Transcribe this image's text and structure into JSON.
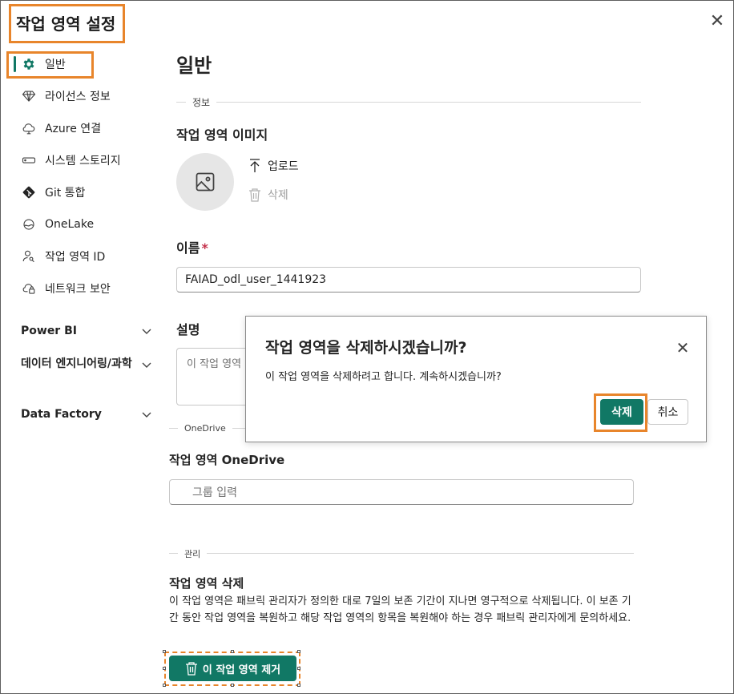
{
  "window": {
    "title": "작업 영역 설정",
    "close_icon": "close-icon"
  },
  "sidebar": {
    "items": [
      {
        "label": "일반",
        "icon": "gear-icon",
        "selected": true
      },
      {
        "label": "라이선스 정보",
        "icon": "diamond-icon"
      },
      {
        "label": "Azure 연결",
        "icon": "cloud-icon"
      },
      {
        "label": "시스템 스토리지",
        "icon": "storage-icon"
      },
      {
        "label": "Git 통합",
        "icon": "git-icon"
      },
      {
        "label": "OneLake",
        "icon": "onelake-icon"
      },
      {
        "label": "작업 영역 ID",
        "icon": "person-key-icon"
      },
      {
        "label": "네트워크 보안",
        "icon": "cloud-lock-icon"
      }
    ],
    "sections": [
      {
        "label": "Power BI"
      },
      {
        "label": "데이터 엔지니어링/과학"
      },
      {
        "label": "Data Factory"
      }
    ]
  },
  "main": {
    "heading": "일반",
    "info_section": "정보",
    "workspace_image_label": "작업 영역 이미지",
    "upload_label": "업로드",
    "delete_image_label": "삭제",
    "name_label": "이름",
    "required_mark": "*",
    "name_value": "FAIAD_odl_user_1441923",
    "description_label": "설명",
    "description_placeholder": "이 작업 영역",
    "onedrive_section": "OneDrive",
    "onedrive_label": "작업 영역 OneDrive",
    "onedrive_placeholder": "그룹 입력",
    "manage_section": "관리",
    "delete_ws_label": "작업 영역 삭제",
    "delete_ws_text": "이 작업 영역은 패브릭 관리자가 정의한 대로 7일의 보존 기간이 지나면 영구적으로 삭제됩니다. 이 보존 기간 동안 작업 영역을 복원하고 해당 작업 영역의 항목을 복원해야 하는 경우 패브릭 관리자에게 문의하세요.",
    "remove_button": "이 작업 영역 제거"
  },
  "dialog": {
    "title": "작업 영역을 삭제하시겠습니까?",
    "message": "이 작업 영역을 삭제하려고 합니다. 계속하시겠습니까?",
    "confirm": "삭제",
    "cancel": "취소"
  },
  "colors": {
    "accent": "#117865",
    "highlight": "#e8852b"
  }
}
